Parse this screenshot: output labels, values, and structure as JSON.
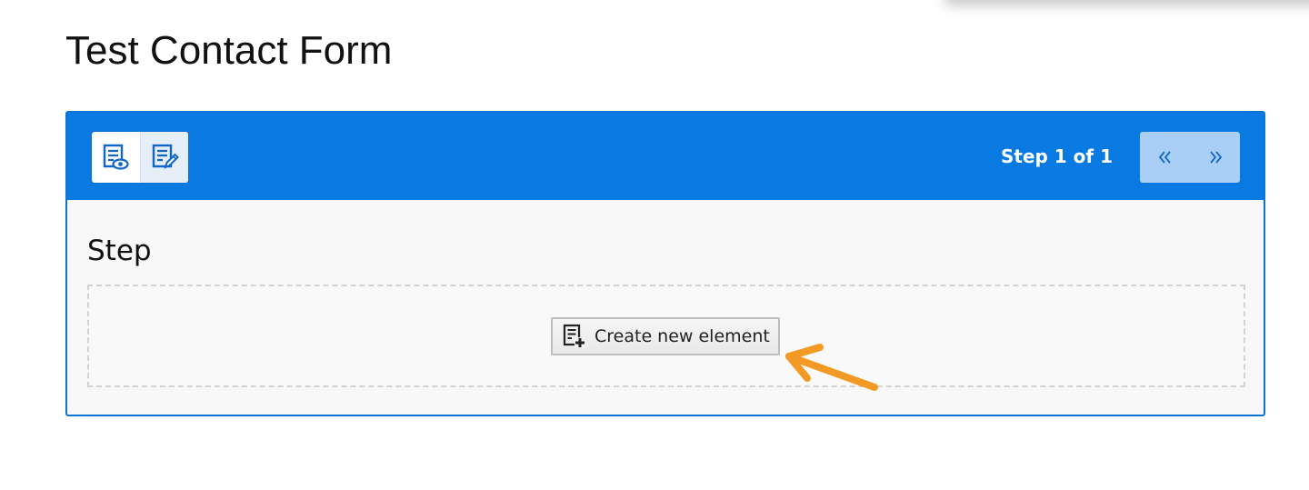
{
  "page": {
    "title": "Test Contact Form"
  },
  "editor": {
    "step_indicator": "Step 1 of 1",
    "step_title": "Step",
    "create_button_label": "Create new element",
    "colors": {
      "header": "#0a7ae3",
      "border": "#0a74d6",
      "pager_bg": "#a9cff6",
      "annotation_arrow": "#f39a24"
    },
    "icons": {
      "preview": "preview-form-icon",
      "edit": "edit-form-icon",
      "previous": "double-chevron-left-icon",
      "next": "double-chevron-right-icon",
      "create": "add-element-icon"
    }
  }
}
